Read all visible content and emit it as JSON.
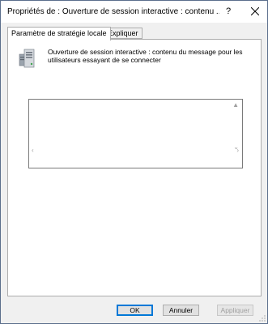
{
  "window": {
    "title": "Propriétés de : Ouverture de session interactive : contenu ...",
    "help_label": "?"
  },
  "tabs": [
    {
      "label": "Paramètre de stratégie locale",
      "active": true
    },
    {
      "label": "Expliquer",
      "active": false
    }
  ],
  "policy": {
    "icon": "server-policy-icon",
    "description": "Ouverture de session interactive : contenu du message pour les utilisateurs essayant de se connecter"
  },
  "message_box": {
    "value": ""
  },
  "buttons": {
    "ok": "OK",
    "cancel": "Annuler",
    "apply": "Appliquer"
  }
}
